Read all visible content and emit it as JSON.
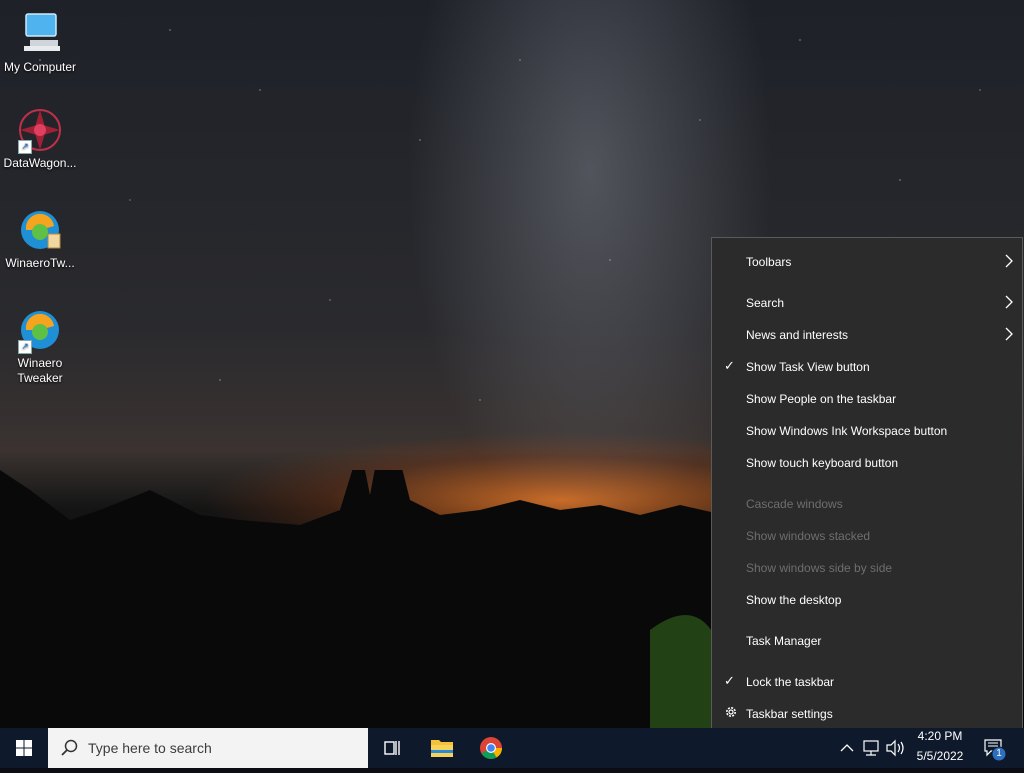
{
  "desktop": {
    "icons": [
      {
        "name": "my-computer",
        "label": "My Computer"
      },
      {
        "name": "datawagon",
        "label": "DataWagon..."
      },
      {
        "name": "winaero-tweaker-1",
        "label": "WinaeroTw..."
      },
      {
        "name": "winaero-tweaker-2",
        "label": "Winaero Tweaker"
      }
    ]
  },
  "context_menu": {
    "items": [
      {
        "label": "Toolbars",
        "submenu": true
      },
      {
        "label": "Search",
        "submenu": true
      },
      {
        "label": "News and interests",
        "submenu": true
      },
      {
        "label": "Show Task View button",
        "checked": true
      },
      {
        "label": "Show People on the taskbar"
      },
      {
        "label": "Show Windows Ink Workspace button"
      },
      {
        "label": "Show touch keyboard button"
      },
      {
        "label": "Cascade windows",
        "disabled": true
      },
      {
        "label": "Show windows stacked",
        "disabled": true
      },
      {
        "label": "Show windows side by side",
        "disabled": true
      },
      {
        "label": "Show the desktop"
      },
      {
        "label": "Task Manager"
      },
      {
        "label": "Lock the taskbar",
        "checked": true
      },
      {
        "label": "Taskbar settings",
        "icon": "gear-icon"
      }
    ]
  },
  "taskbar": {
    "search_placeholder": "Type here to search",
    "apps": [
      "task-view-icon",
      "file-explorer-icon",
      "chrome-icon"
    ],
    "tray": {
      "icons": [
        "chevron-up-icon",
        "network-icon",
        "volume-icon"
      ],
      "time": "4:20 PM",
      "date": "5/5/2022",
      "notification_count": "1"
    }
  },
  "colors": {
    "menu_bg": "#2b2b2b",
    "taskbar_bg": "#0e1a2b",
    "disabled_text": "#6e6e6e"
  }
}
